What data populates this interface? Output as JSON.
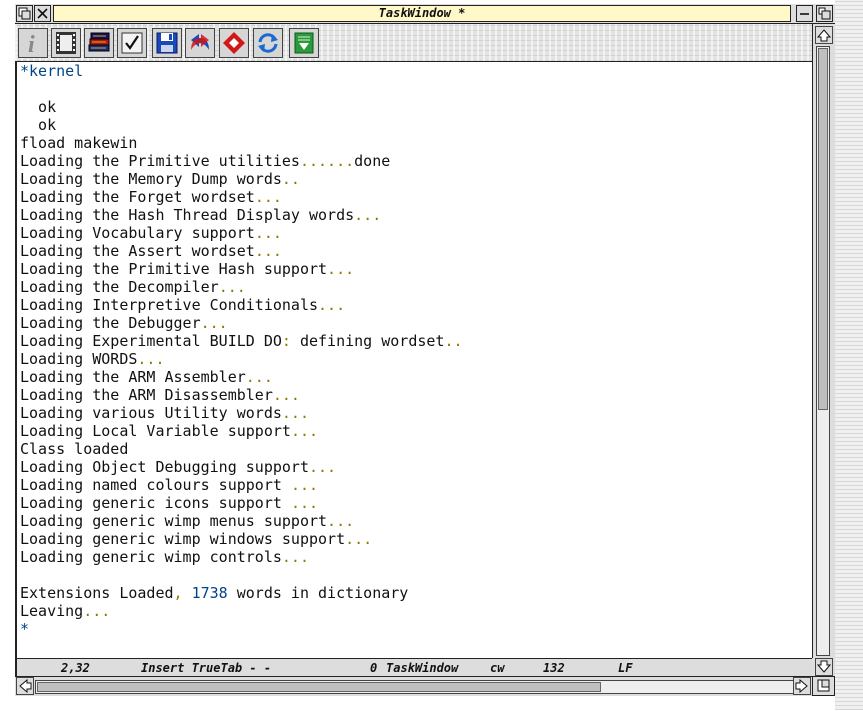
{
  "window": {
    "title": "TaskWindow *"
  },
  "toolbar": {
    "buttons": [
      {
        "name": "info-button",
        "icon": "info-icon"
      },
      {
        "name": "film-button",
        "icon": "film-icon"
      },
      {
        "name": "books-button",
        "icon": "books-icon"
      },
      {
        "name": "check-button",
        "icon": "checkmark-icon"
      },
      {
        "name": "save-button",
        "icon": "floppy-disk-icon"
      },
      {
        "name": "undo-button",
        "icon": "undo-arrow-icon"
      },
      {
        "name": "find-button",
        "icon": "diamond-icon"
      },
      {
        "name": "refresh-button",
        "icon": "refresh-icon"
      },
      {
        "name": "download-button",
        "icon": "download-icon"
      }
    ]
  },
  "colors": {
    "prompt_blue": "#004488",
    "dots_olive": "#8a7a00",
    "title_bg": "#fff8c8"
  },
  "output": {
    "lines": [
      {
        "text": "*kernel",
        "cls": "blue"
      },
      {
        "text": ""
      },
      {
        "text": "  ok"
      },
      {
        "text": "  ok"
      },
      {
        "text": "fload makewin"
      },
      {
        "text": "Loading the Primitive utilities",
        "dots": "......",
        "tail": "done"
      },
      {
        "text": "Loading the Memory Dump words",
        "dots": ".."
      },
      {
        "text": "Loading the Forget wordset",
        "dots": "..."
      },
      {
        "text": "Loading the Hash Thread Display words",
        "dots": "..."
      },
      {
        "text": "Loading Vocabulary support",
        "dots": "..."
      },
      {
        "text": "Loading the Assert wordset",
        "dots": "..."
      },
      {
        "text": "Loading the Primitive Hash support",
        "dots": "..."
      },
      {
        "text": "Loading the Decompiler",
        "dots": "..."
      },
      {
        "text": "Loading Interpretive Conditionals",
        "dots": "..."
      },
      {
        "text": "Loading the Debugger",
        "dots": "..."
      },
      {
        "text": "Loading Experimental BUILD DO",
        "dots": ":",
        "tail": " defining wordset",
        "dots2": ".."
      },
      {
        "text": "Loading WORDS",
        "dots": "..."
      },
      {
        "text": "Loading the ARM Assembler",
        "dots": "..."
      },
      {
        "text": "Loading the ARM Disassembler",
        "dots": "..."
      },
      {
        "text": "Loading various Utility words",
        "dots": "..."
      },
      {
        "text": "Loading Local Variable support",
        "dots": "..."
      },
      {
        "text": "Class loaded"
      },
      {
        "text": "Loading Object Debugging support",
        "dots": "..."
      },
      {
        "text": "Loading named colours support ",
        "dots": "..."
      },
      {
        "text": "Loading generic icons support ",
        "dots": "..."
      },
      {
        "text": "Loading generic wimp menus support",
        "dots": "..."
      },
      {
        "text": "Loading generic wimp windows support",
        "dots": "..."
      },
      {
        "text": "Loading generic wimp controls",
        "dots": "..."
      },
      {
        "text": ""
      },
      {
        "text": "Extensions Loaded",
        "dots": ",",
        "num": " 1738",
        "tail": " words in dictionary"
      },
      {
        "text": "Leaving",
        "dots": "..."
      },
      {
        "text": "*",
        "cls": "blue"
      }
    ]
  },
  "status": {
    "position": "2,32",
    "mode": "Insert TrueTab - -",
    "count": "0",
    "task": "TaskWindow",
    "wrap": "cw",
    "width": "132",
    "eol": "LF"
  }
}
